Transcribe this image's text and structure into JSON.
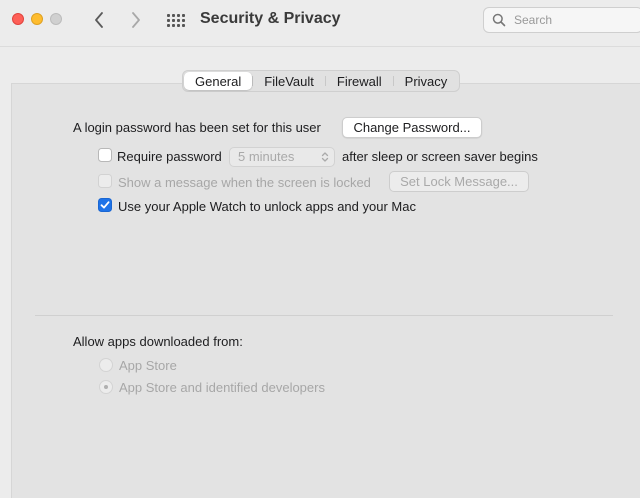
{
  "window": {
    "title": "Security & Privacy"
  },
  "search": {
    "placeholder": "Search"
  },
  "tabs": [
    {
      "label": "General",
      "active": true
    },
    {
      "label": "FileVault",
      "active": false
    },
    {
      "label": "Firewall",
      "active": false
    },
    {
      "label": "Privacy",
      "active": false
    }
  ],
  "general": {
    "login_password_text": "A login password has been set for this user",
    "change_password_label": "Change Password...",
    "require_password_label": "Require password",
    "require_password_checked": false,
    "require_password_interval": "5 minutes",
    "after_sleep_text": "after sleep or screen saver begins",
    "show_message_label": "Show a message when the screen is locked",
    "show_message_checked": false,
    "set_lock_message_label": "Set Lock Message...",
    "apple_watch_label": "Use your Apple Watch to unlock apps and your Mac",
    "apple_watch_checked": true,
    "allow_apps_heading": "Allow apps downloaded from:",
    "app_sources": [
      {
        "label": "App Store",
        "selected": false
      },
      {
        "label": "App Store and identified developers",
        "selected": true
      }
    ]
  },
  "colors": {
    "accent": "#1e73e8",
    "close": "#fe5f57",
    "minimize": "#febc2e",
    "zoom_disabled": "#d0d0d0"
  }
}
